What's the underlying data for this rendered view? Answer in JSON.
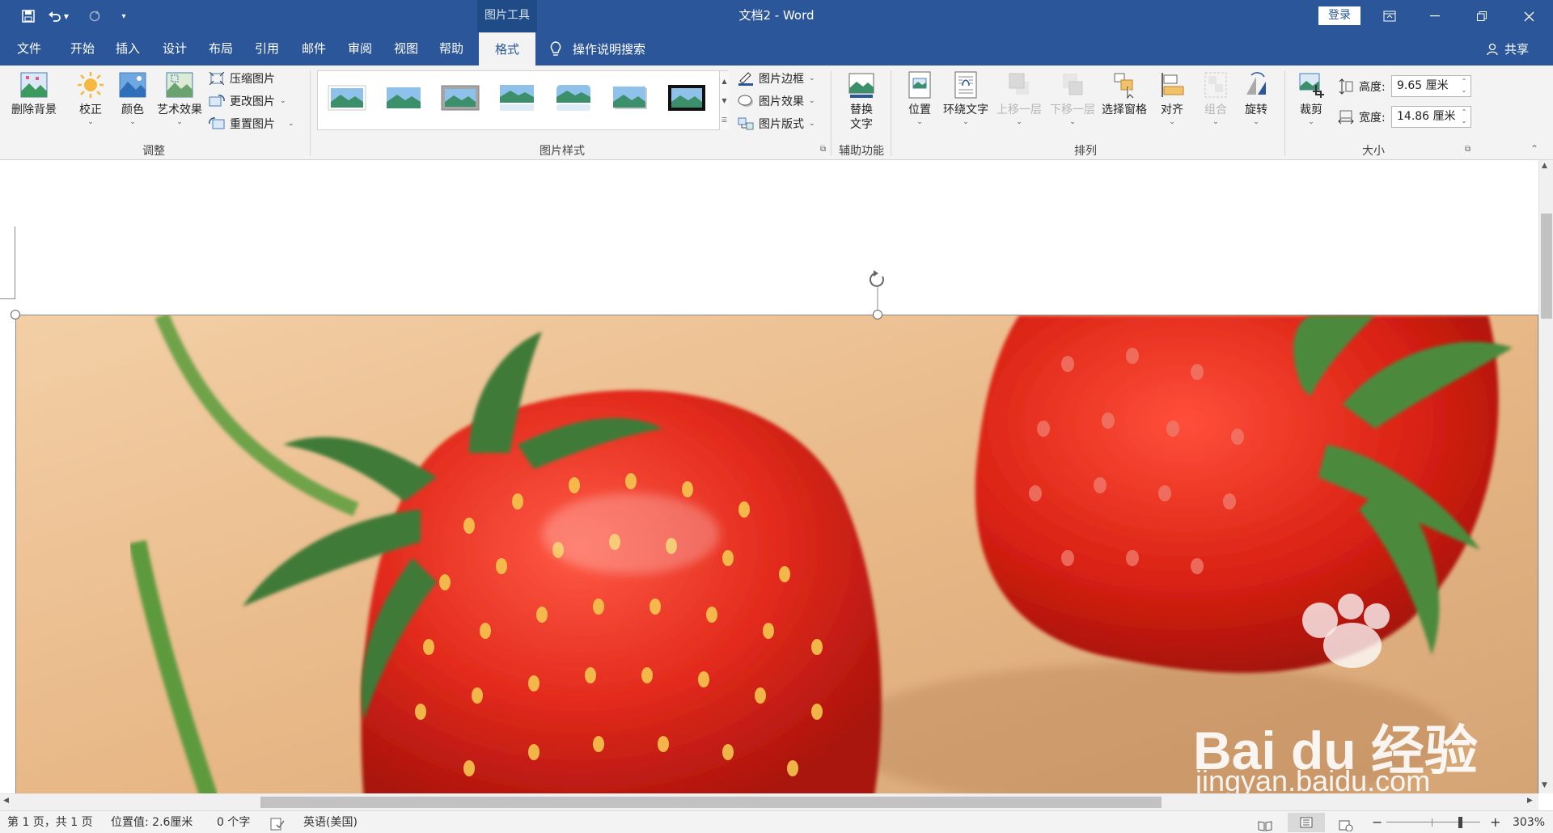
{
  "window": {
    "title": "文档2  -  Word",
    "context_group": "图片工具",
    "login": "登录"
  },
  "tabs": [
    "文件",
    "开始",
    "插入",
    "设计",
    "布局",
    "引用",
    "邮件",
    "审阅",
    "视图",
    "帮助",
    "格式"
  ],
  "active_tab": "格式",
  "tell_me": "操作说明搜索",
  "share": "共享",
  "ribbon": {
    "adjust": {
      "remove_bg": "删除背景",
      "corrections": "校正",
      "color": "颜色",
      "artistic": "艺术效果",
      "compress": "压缩图片",
      "change": "更改图片",
      "reset": "重置图片",
      "label": "调整"
    },
    "styles": {
      "border": "图片边框",
      "effects": "图片效果",
      "layout": "图片版式",
      "label": "图片样式"
    },
    "accessibility": {
      "alt_text": "替换文字",
      "label": "辅助功能"
    },
    "arrange": {
      "position": "位置",
      "wrap": "环绕文字",
      "forward": "上移一层",
      "backward": "下移一层",
      "selection_pane": "选择窗格",
      "align": "对齐",
      "group": "组合",
      "rotate": "旋转",
      "label": "排列"
    },
    "size": {
      "crop": "裁剪",
      "height_label": "高度:",
      "height_value": "9.65 厘米",
      "width_label": "宽度:",
      "width_value": "14.86 厘米",
      "label": "大小"
    }
  },
  "watermark": {
    "brand": "Bai du 经验",
    "url": "jingyan.baidu.com"
  },
  "status": {
    "page": "第 1 页，共 1 页",
    "position": "位置值: 2.6厘米",
    "words": "0 个字",
    "language": "英语(美国)",
    "zoom": "303%"
  },
  "colors": {
    "accent": "#2b579a",
    "ribbon_bg": "#f3f3f3"
  }
}
